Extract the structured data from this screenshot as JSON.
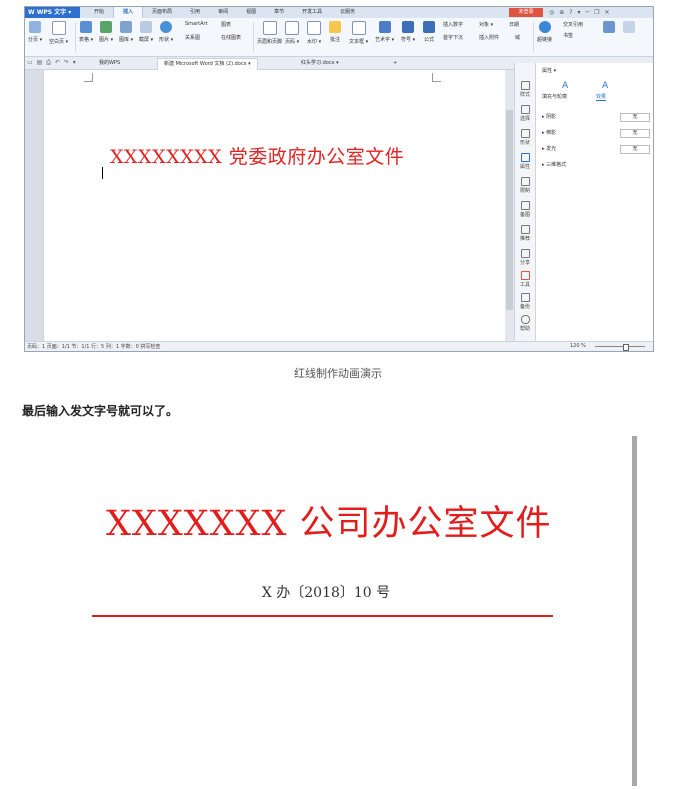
{
  "colors": {
    "redhead": "#e32222",
    "wps_blue": "#2f6fcf",
    "login_red": "#e0533f"
  },
  "wps": {
    "app_menu": "W WPS 文字 ▾",
    "menu_tabs": [
      "开始",
      "插入",
      "页面布局",
      "引用",
      "审阅",
      "视图",
      "章节",
      "开发工具",
      "云服务"
    ],
    "active_tab": "插入",
    "login": "未登录",
    "window_controls": [
      "◎",
      "⊕",
      "?",
      "▾",
      "─",
      "❐",
      "✕"
    ],
    "ribbon": {
      "buttons": [
        {
          "label": "分页 ▾",
          "icon": "page-break-icon"
        },
        {
          "label": "空白页 ▾",
          "icon": "blank-page-icon"
        },
        {
          "label": "表格 ▾",
          "icon": "table-icon"
        },
        {
          "label": "图片 ▾",
          "icon": "picture-icon"
        },
        {
          "label": "图库 ▾",
          "icon": "gallery-icon"
        },
        {
          "label": "截屏 ▾",
          "icon": "screenshot-icon"
        },
        {
          "label": "形状 ▾",
          "icon": "shapes-icon"
        },
        {
          "label": "页眉和页脚",
          "icon": "header-footer-icon"
        },
        {
          "label": "页码 ▾",
          "icon": "page-number-icon"
        },
        {
          "label": "水印 ▾",
          "icon": "watermark-icon"
        },
        {
          "label": "批注",
          "icon": "comment-icon"
        },
        {
          "label": "文本框 ▾",
          "icon": "textbox-icon"
        },
        {
          "label": "艺术字 ▾",
          "icon": "art-text-icon"
        },
        {
          "label": "符号 ▾",
          "icon": "symbol-icon"
        },
        {
          "label": "公式",
          "icon": "formula-icon"
        },
        {
          "label": "超链接",
          "icon": "hyperlink-icon"
        },
        {
          "label": "书签",
          "icon": "bookmark-icon"
        }
      ],
      "small": [
        "SmartArt",
        "图表",
        "关系图",
        "在线图表",
        "插入数字",
        "对象 ▾",
        "日期",
        "首字下沉",
        "插入附件",
        "域",
        "交叉引用"
      ]
    },
    "doc_tabs": [
      "我的WPS",
      "新建 Microsoft Word 文档 (2).docx ▾",
      "红头学习.docx ▾",
      "+"
    ],
    "active_doc_tab": "新建 Microsoft Word 文档 (2).docx ▾",
    "document": {
      "heading": "XXXXXXXX 党委政府办公室文件"
    },
    "icon_bar": [
      "样式",
      "选择",
      "形状",
      "属性",
      "限制",
      "备图",
      "推荐",
      "分享",
      "工具",
      "备份",
      "帮助"
    ],
    "side_panel": {
      "title": "属性 ▾",
      "tabs": [
        "填充与轮廓",
        "效果"
      ],
      "rows": [
        {
          "label": "▸ 阴影",
          "value": "无"
        },
        {
          "label": "▸ 倒影",
          "value": "无"
        },
        {
          "label": "▸ 发光",
          "value": "无"
        },
        {
          "label": "▸ 三维格式",
          "value": ""
        }
      ]
    },
    "status": "页码：1  页面：1/1  节：1/1  行：5  列：1  字数：0  拼写检查",
    "zoom": "120 %"
  },
  "caption": "红线制作动画演示",
  "step_text": "最后输入发文字号就可以了。",
  "final_doc": {
    "title": "XXXXXXX 公司办公室文件",
    "doc_number": "X 办〔2018〕10 号"
  }
}
